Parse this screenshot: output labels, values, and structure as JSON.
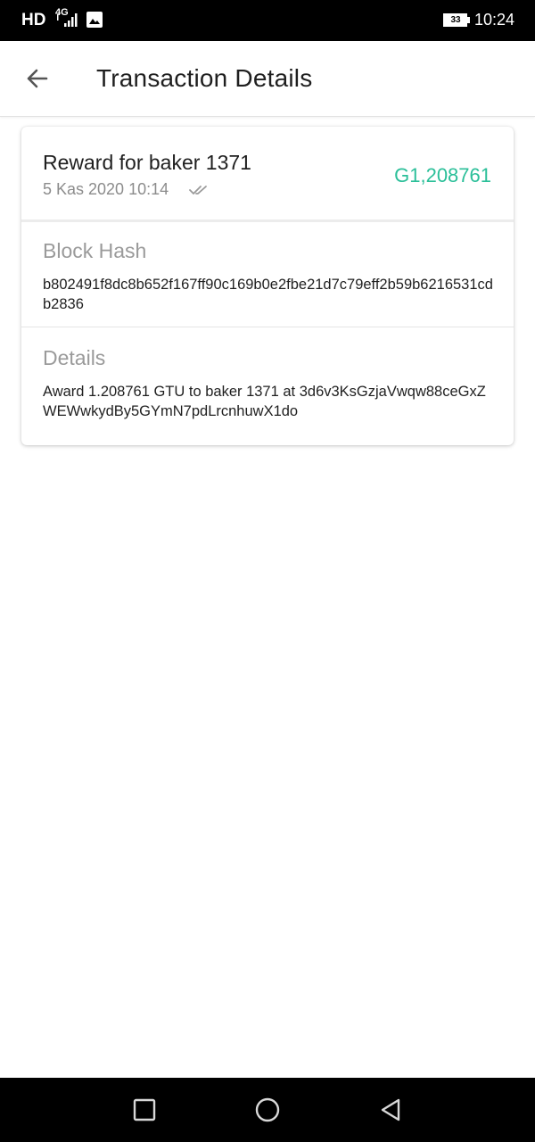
{
  "status_bar": {
    "network_hd": "HD",
    "network_type": "4G",
    "battery": "33",
    "time": "10:24"
  },
  "app_bar": {
    "title": "Transaction Details"
  },
  "transaction": {
    "title": "Reward for baker 1371",
    "date": "5 Kas 2020 10:14",
    "amount": "G1,208761",
    "amount_color": "#2bbf99"
  },
  "block_hash": {
    "label": "Block Hash",
    "value": "b802491f8dc8b652f167ff90c169b0e2fbe21d7c79eff2b59b6216531cdb2836"
  },
  "details": {
    "label": "Details",
    "value": "Award 1.208761 GTU to baker 1371 at 3d6v3KsGzjaVwqw88ceGxZWEWwkydBy5GYmN7pdLrcnhuwX1do"
  },
  "icons": {
    "back": "arrow-back-icon",
    "check": "double-check-icon",
    "nav_recent": "square-icon",
    "nav_home": "circle-icon",
    "nav_back": "triangle-back-icon"
  }
}
